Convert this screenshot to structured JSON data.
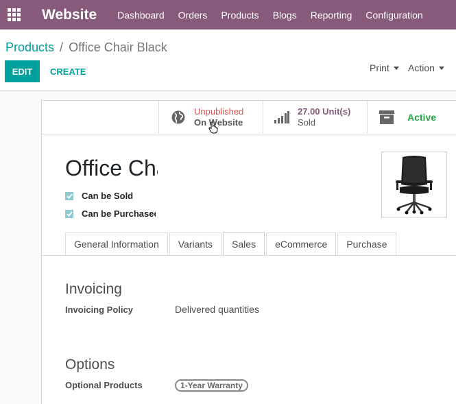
{
  "navbar": {
    "brand": "Website",
    "menu": [
      "Dashboard",
      "Orders",
      "Products",
      "Blogs",
      "Reporting",
      "Configuration"
    ]
  },
  "breadcrumb": {
    "parent": "Products",
    "separator": "/",
    "current": "Office Chair Black"
  },
  "toolbar": {
    "edit": "EDIT",
    "create": "CREATE",
    "print": "Print",
    "action": "Action"
  },
  "smart_buttons": {
    "publish": {
      "status": "Unpublished",
      "sub": "On Website"
    },
    "sold": {
      "value": "27.00 Unit(s)",
      "sub": "Sold"
    },
    "active": {
      "label": "Active"
    }
  },
  "product": {
    "name": "Office Chair Black",
    "can_be_sold": "Can be Sold",
    "can_be_purchased": "Can be Purchased"
  },
  "tabs": [
    "General Information",
    "Variants",
    "Sales",
    "eCommerce",
    "Purchase"
  ],
  "sales": {
    "invoicing": {
      "title": "Invoicing",
      "policy_label": "Invoicing Policy",
      "policy_value": "Delivered quantities"
    },
    "options": {
      "title": "Options",
      "optional_label": "Optional Products",
      "optional_tag": "1-Year Warranty"
    }
  },
  "colors": {
    "brand": "#875a7b",
    "accent": "#00a09d",
    "unpublished": "#d9534f",
    "active": "#28a745"
  },
  "icons": {
    "apps": "apps-grid-icon",
    "globe": "globe-icon",
    "chart": "bar-chart-icon",
    "archive": "archive-icon"
  }
}
